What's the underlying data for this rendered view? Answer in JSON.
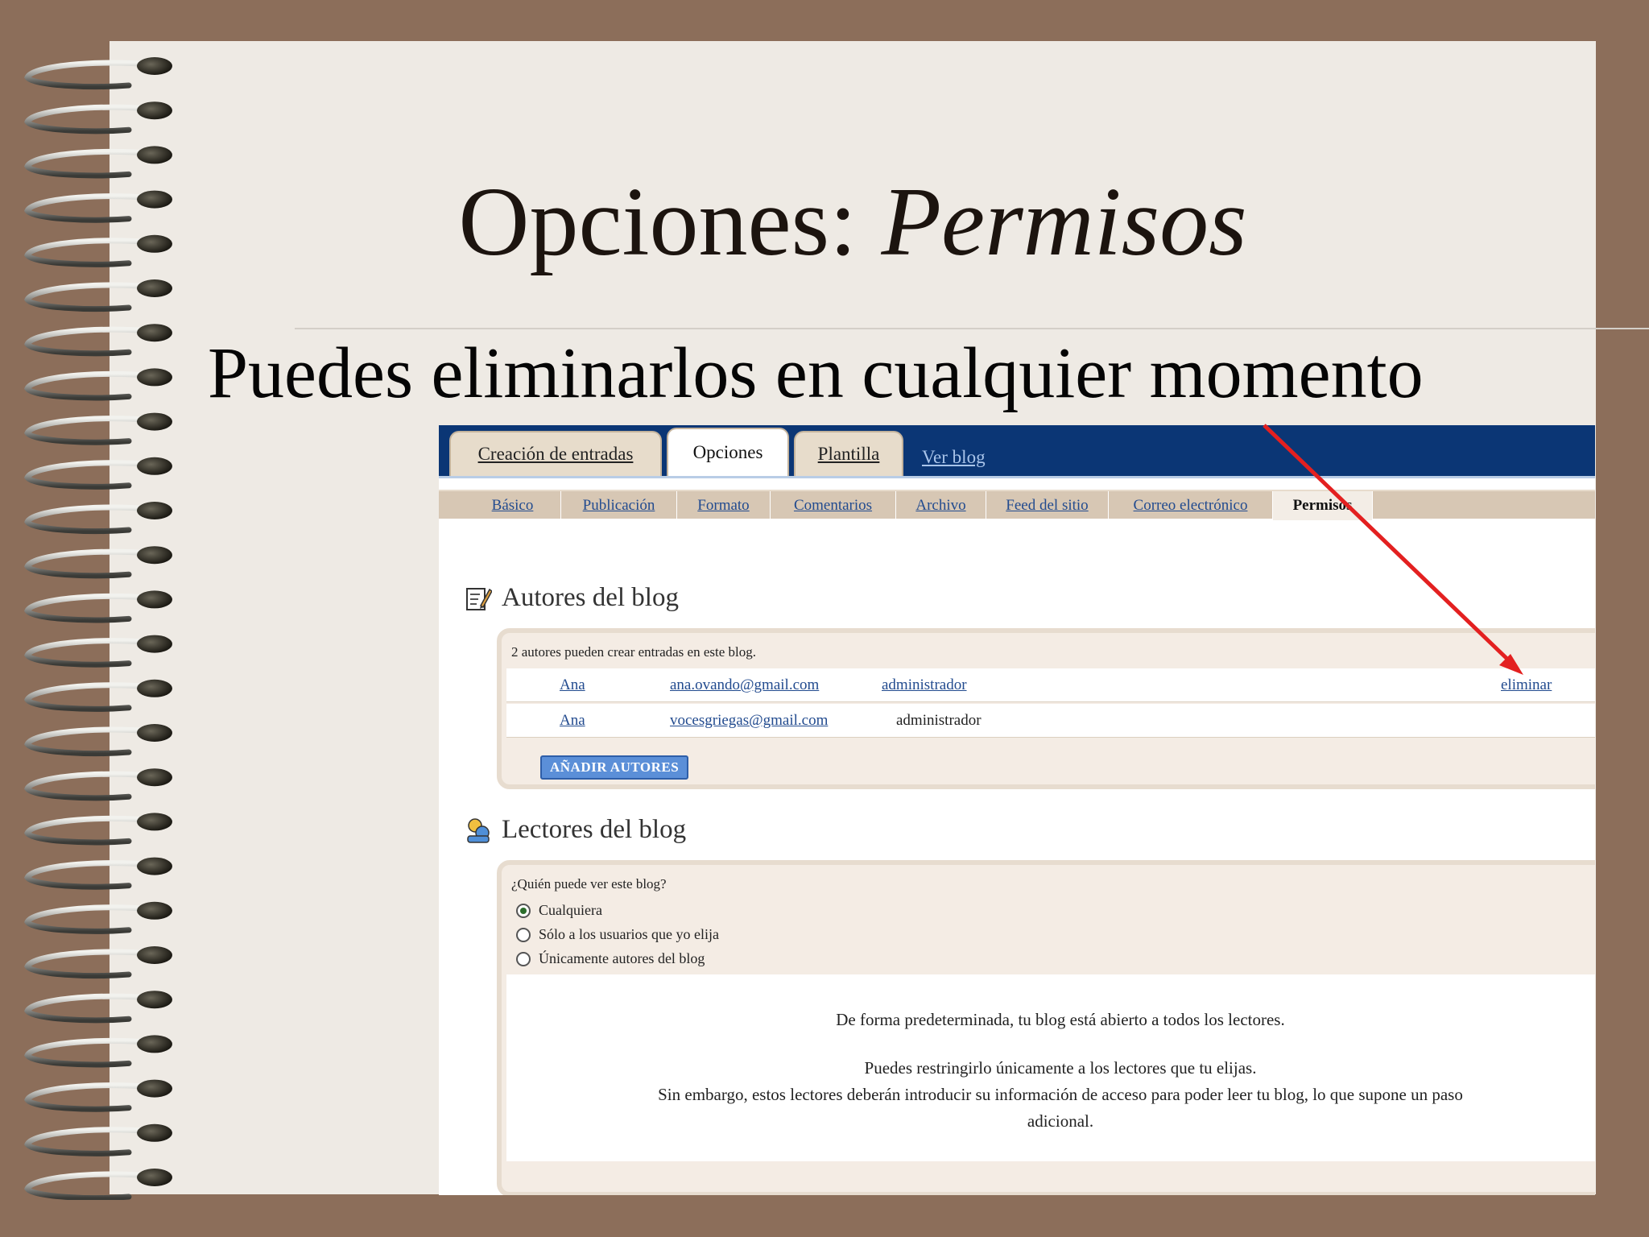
{
  "slide": {
    "title_main": "Opciones:",
    "title_italic": "Permisos",
    "bullet": "Puedes eliminarlos en cualquier momento"
  },
  "topnav": {
    "tabs": [
      {
        "label": "Creación de entradas"
      },
      {
        "label": "Opciones"
      },
      {
        "label": "Plantilla"
      }
    ],
    "link": "Ver blog"
  },
  "subnav": {
    "items": [
      {
        "label": "Básico"
      },
      {
        "label": "Publicación"
      },
      {
        "label": "Formato"
      },
      {
        "label": "Comentarios"
      },
      {
        "label": "Archivo"
      },
      {
        "label": "Feed del sitio"
      },
      {
        "label": "Correo electrónico"
      },
      {
        "label": "Permisos"
      }
    ],
    "active": "Permisos"
  },
  "authors": {
    "title": "Autores del blog",
    "count_text": "2 autores pueden crear entradas en este blog.",
    "rows": [
      {
        "name": "Ana",
        "email": "ana.ovando@gmail.com",
        "role": "administrador",
        "action": "eliminar"
      },
      {
        "name": "Ana",
        "email": "vocesgriegas@gmail.com",
        "role": "administrador"
      }
    ],
    "add_button": "AÑADIR AUTORES"
  },
  "readers": {
    "title": "Lectores del blog",
    "question": "¿Quién puede ver este blog?",
    "options": [
      {
        "label": "Cualquiera",
        "selected": true
      },
      {
        "label": "Sólo a los usuarios que yo elija",
        "selected": false
      },
      {
        "label": "Únicamente autores del blog",
        "selected": false
      }
    ],
    "info_line1": "De forma predeterminada, tu blog está abierto a todos los lectores.",
    "info_line2": "Puedes restringirlo únicamente a los lectores que tu elijas.",
    "info_line3": "Sin embargo, estos lectores deberán introducir su información de acceso para poder leer tu blog, lo que supone un paso",
    "info_line4": "adicional."
  },
  "colors": {
    "background": "#8c6e5a",
    "page": "#eeeae4",
    "header_bar": "#0b3675",
    "link": "#224b8f",
    "arrow": "#e32020"
  }
}
